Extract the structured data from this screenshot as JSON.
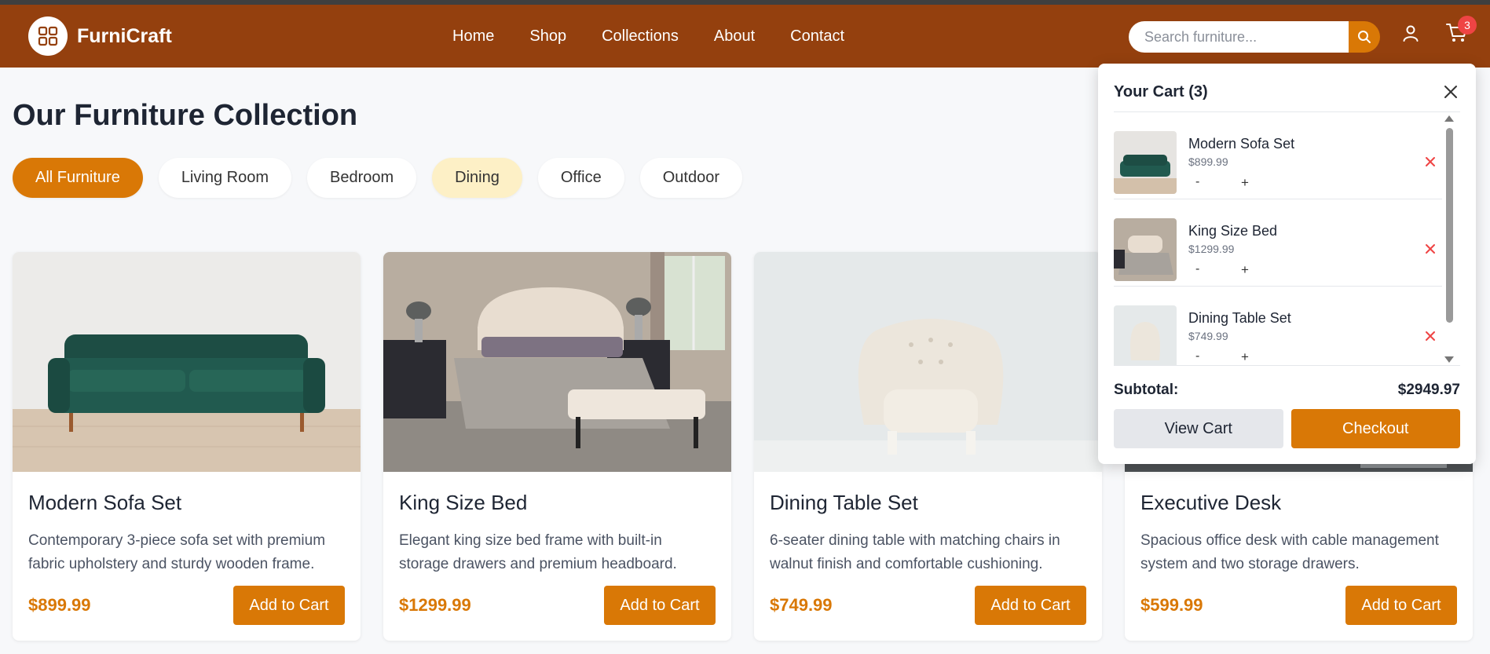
{
  "brand": {
    "name": "FurniCraft"
  },
  "nav": {
    "links": [
      "Home",
      "Shop",
      "Collections",
      "About",
      "Contact"
    ]
  },
  "search": {
    "placeholder": "Search furniture..."
  },
  "cart_badge": "3",
  "page_title": "Our Furniture Collection",
  "filters": [
    "All Furniture",
    "Living Room",
    "Bedroom",
    "Dining",
    "Office",
    "Outdoor"
  ],
  "products": [
    {
      "title": "Modern Sofa Set",
      "desc": "Contemporary 3-piece sofa set with premium fabric upholstery and sturdy wooden frame.",
      "price": "$899.99",
      "button": "Add to Cart"
    },
    {
      "title": "King Size Bed",
      "desc": "Elegant king size bed frame with built-in storage drawers and premium headboard.",
      "price": "$1299.99",
      "button": "Add to Cart"
    },
    {
      "title": "Dining Table Set",
      "desc": "6-seater dining table with matching chairs in walnut finish and comfortable cushioning.",
      "price": "$749.99",
      "button": "Add to Cart"
    },
    {
      "title": "Executive Desk",
      "desc": "Spacious office desk with cable management system and two storage drawers.",
      "price": "$599.99",
      "button": "Add to Cart"
    }
  ],
  "cart": {
    "title": "Your Cart (3)",
    "items": [
      {
        "name": "Modern Sofa Set",
        "price": "$899.99",
        "minus": "-",
        "plus": "+"
      },
      {
        "name": "King Size Bed",
        "price": "$1299.99",
        "minus": "-",
        "plus": "+"
      },
      {
        "name": "Dining Table Set",
        "price": "$749.99",
        "minus": "-",
        "plus": "+"
      }
    ],
    "subtotal_label": "Subtotal:",
    "subtotal_value": "$2949.97",
    "view_cart": "View Cart",
    "checkout": "Checkout"
  },
  "colors": {
    "header": "#94400e",
    "accent": "#d97806",
    "remove": "#ef4444",
    "chip_hover": "#fdf0c6"
  },
  "icons": [
    "grid-logo-icon",
    "search-icon",
    "user-icon",
    "cart-icon",
    "close-icon",
    "remove-icon"
  ]
}
